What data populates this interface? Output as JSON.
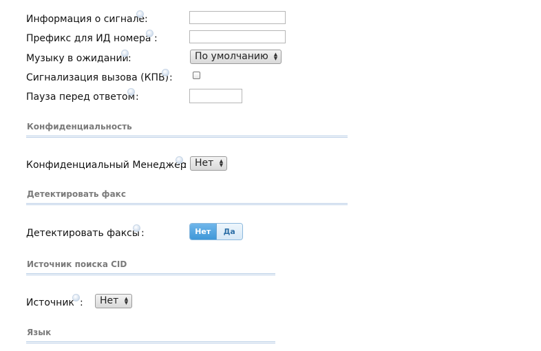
{
  "fields": {
    "signal_info": {
      "label": "Информация о сигнале",
      "colon": ":",
      "value": ""
    },
    "id_prefix": {
      "label": "Префикс для ИД номера",
      "colon": ":",
      "value": ""
    },
    "music_on_hold": {
      "label": "Музыку в ожидании",
      "colon": ":",
      "selected": "По умолчанию"
    },
    "call_alert": {
      "label": "Сигнализация вызова (КПВ)",
      "colon": ":",
      "checked": false
    },
    "answer_pause": {
      "label": "Пауза перед ответом",
      "colon": ":",
      "value": ""
    }
  },
  "sections": {
    "privacy": {
      "title": "Конфиденциальность",
      "manager": {
        "label": "Конфиденциальный Менеджер",
        "colon": ":",
        "selected": "Нет"
      }
    },
    "fax": {
      "title": "Детектировать факс",
      "detect": {
        "label": "Детектировать факсы",
        "colon": ":",
        "options": [
          "Нет",
          "Да"
        ],
        "selected": "Нет"
      }
    },
    "cid": {
      "title": "Источник поиска CID",
      "source": {
        "label": "Источник",
        "colon": ":",
        "selected": "Нет"
      }
    },
    "language": {
      "title": "Язык"
    }
  },
  "colors": {
    "accent": "#3f98d8",
    "section_rule": "#b8cde6",
    "section_title": "#7a7a7a"
  }
}
